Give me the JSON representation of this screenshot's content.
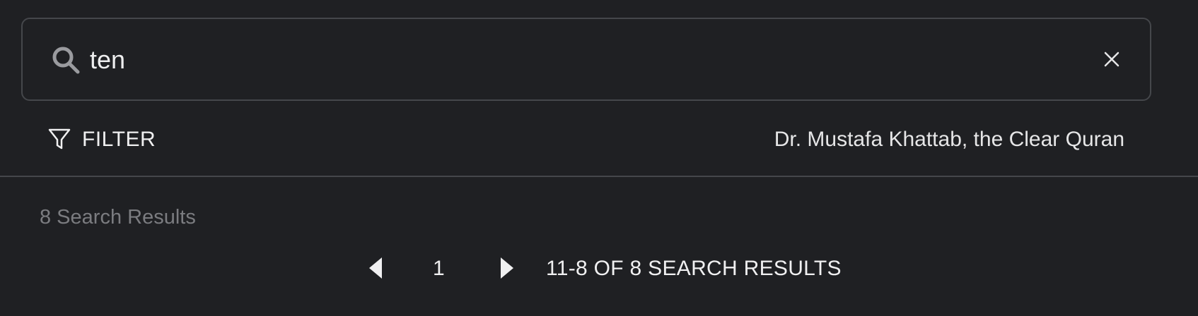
{
  "search": {
    "value": "ten",
    "icon": "search-icon",
    "clear_icon": "close-icon"
  },
  "filter": {
    "label": "FILTER",
    "icon": "filter-funnel-icon"
  },
  "translation": {
    "label": "Dr. Mustafa Khattab, the Clear Quran"
  },
  "results": {
    "count_text": "8 Search Results"
  },
  "pagination": {
    "prev_icon": "chevron-left-icon",
    "current_page": "1",
    "next_icon": "chevron-right-icon",
    "range_text": "11-8 OF 8 SEARCH RESULTS"
  },
  "colors": {
    "background": "#1f2023",
    "border": "#45474b",
    "text": "#f0f0f1",
    "muted_text": "#7b7c80"
  }
}
